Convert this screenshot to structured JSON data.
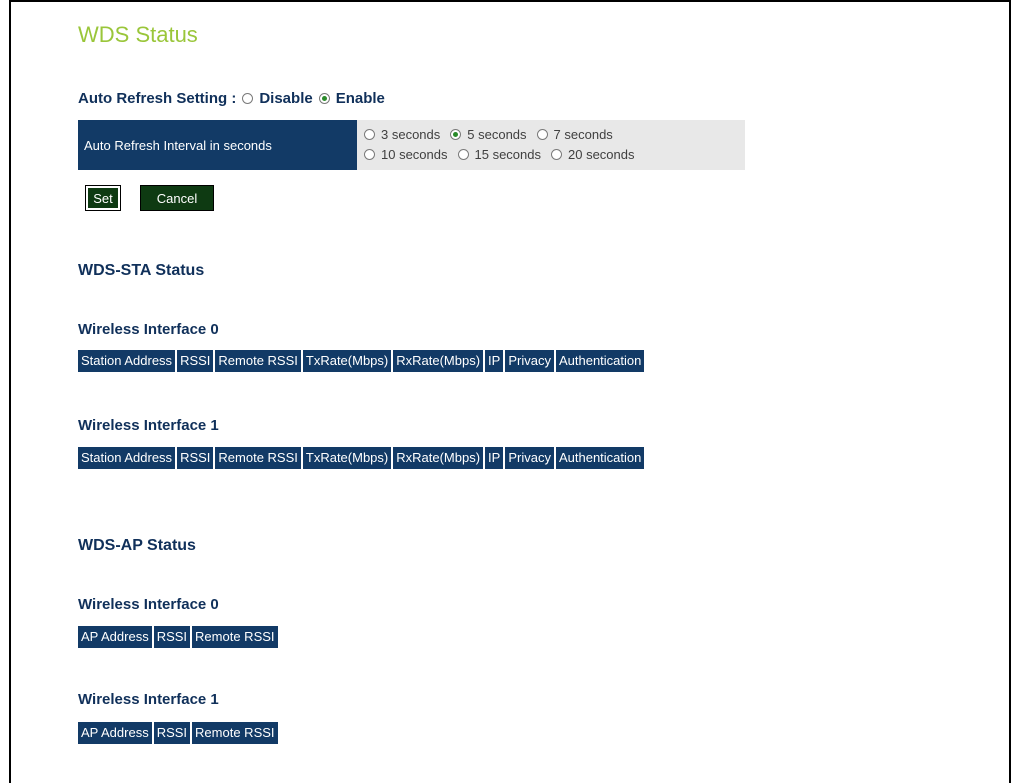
{
  "page": {
    "title": "WDS Status"
  },
  "auto_refresh": {
    "label": "Auto Refresh Setting :",
    "options": [
      {
        "label": "Disable",
        "checked": false
      },
      {
        "label": "Enable",
        "checked": true
      }
    ]
  },
  "interval": {
    "label": "Auto Refresh Interval in seconds",
    "options": [
      {
        "label": "3 seconds",
        "checked": false
      },
      {
        "label": "5 seconds",
        "checked": true
      },
      {
        "label": "7 seconds",
        "checked": false
      },
      {
        "label": "10 seconds",
        "checked": false
      },
      {
        "label": "15 seconds",
        "checked": false
      },
      {
        "label": "20 seconds",
        "checked": false
      }
    ]
  },
  "buttons": {
    "set": "Set",
    "cancel": "Cancel"
  },
  "wds_sta": {
    "title": "WDS-STA Status",
    "interfaces": [
      {
        "title": "Wireless Interface 0"
      },
      {
        "title": "Wireless Interface 1"
      }
    ],
    "columns": [
      "Station Address",
      "RSSI",
      "Remote RSSI",
      "TxRate(Mbps)",
      "RxRate(Mbps)",
      "IP",
      "Privacy",
      "Authentication"
    ]
  },
  "wds_ap": {
    "title": "WDS-AP Status",
    "interfaces": [
      {
        "title": "Wireless Interface 0"
      },
      {
        "title": "Wireless Interface 1"
      }
    ],
    "columns": [
      "AP Address",
      "RSSI",
      "Remote RSSI"
    ]
  },
  "colors": {
    "title": "#9ac63a",
    "header_bg": "#123a66",
    "button_bg": "#0e3a12",
    "text": "#10305a"
  }
}
